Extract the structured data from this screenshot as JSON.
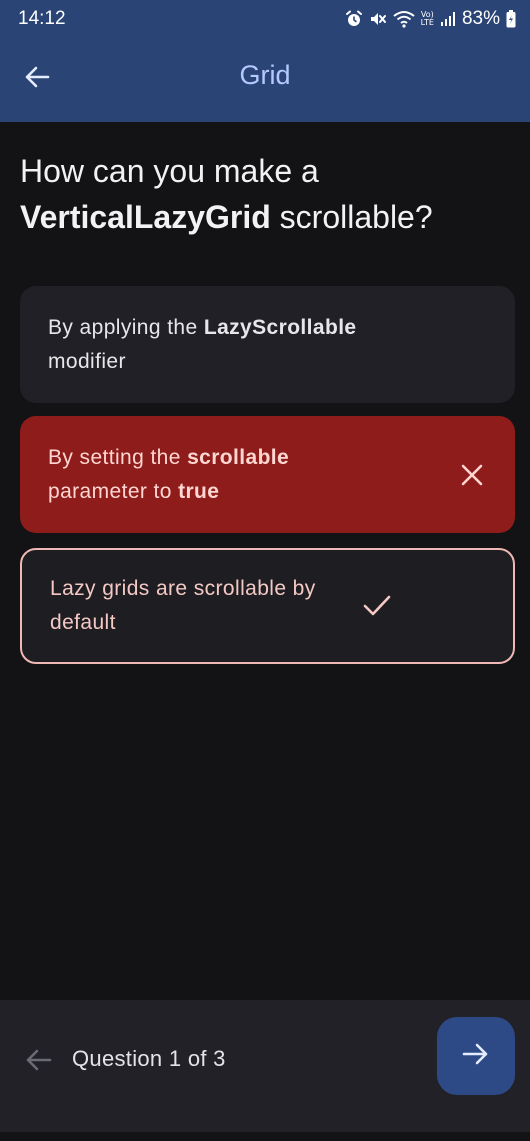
{
  "status_bar": {
    "time": "14:12",
    "lte_top": "Vo)",
    "lte_bottom": "LTE",
    "battery_percent": "83%",
    "icons": [
      "alarm-icon",
      "mute-icon",
      "wifi-icon",
      "lte-icon",
      "signal-icon",
      "battery-icon"
    ]
  },
  "app_bar": {
    "title": "Grid",
    "back_icon": "arrow-left-icon"
  },
  "question": {
    "prefix": "How can you make a ",
    "bold": "VerticalLazyGrid",
    "suffix": " scrollable?"
  },
  "options": [
    {
      "text_before": "By applying the ",
      "text_bold": "LazyScrollable",
      "text_after": " modifier",
      "state": "neutral"
    },
    {
      "text_before": "By setting the ",
      "text_bold": "scrollable",
      "text_middle": " parameter to ",
      "text_bold_2": "true",
      "state": "incorrect",
      "icon": "close-icon"
    },
    {
      "text": "Lazy grids are scrollable by default",
      "state": "correct",
      "icon": "check-icon"
    }
  ],
  "bottom_nav": {
    "counter": "Question 1 of 3",
    "prev_icon": "arrow-left-icon",
    "next_icon": "arrow-right-icon"
  },
  "colors": {
    "header_bg": "#2a4476",
    "title_color": "#b6c9ff",
    "incorrect_bg": "#8e1c1a",
    "correct_border": "#f0b8b4",
    "next_button_bg": "#2d4a86"
  }
}
